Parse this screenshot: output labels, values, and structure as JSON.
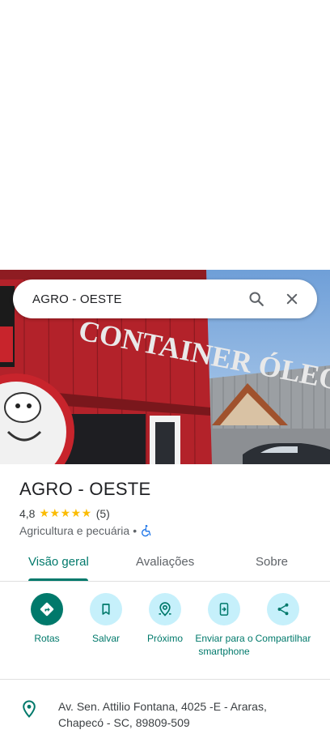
{
  "search": {
    "query": "AGRO - OESTE"
  },
  "hero": {
    "building_sign": "CONTAINER ÓLEO"
  },
  "place": {
    "name": "AGRO - OESTE",
    "rating": "4,8",
    "stars": "★★★★★",
    "review_count": "(5)",
    "category": "Agricultura e pecuária",
    "separator": "•"
  },
  "tabs": [
    {
      "label": "Visão geral",
      "active": true
    },
    {
      "label": "Avaliações",
      "active": false
    },
    {
      "label": "Sobre",
      "active": false
    }
  ],
  "actions": [
    {
      "label": "Rotas",
      "icon": "directions-icon"
    },
    {
      "label": "Salvar",
      "icon": "bookmark-icon"
    },
    {
      "label": "Próximo",
      "icon": "nearby-icon"
    },
    {
      "label": "Enviar para o smartphone",
      "icon": "send-to-phone-icon"
    },
    {
      "label": "Compartilhar",
      "icon": "share-icon"
    }
  ],
  "address": {
    "line1": "Av. Sen. Attilio Fontana, 4025 -E - Araras,",
    "line2": "Chapecó - SC, 89809-509"
  },
  "colors": {
    "accent": "#00796b",
    "action_bg": "#c6f0fb",
    "star": "#fbbc04"
  }
}
